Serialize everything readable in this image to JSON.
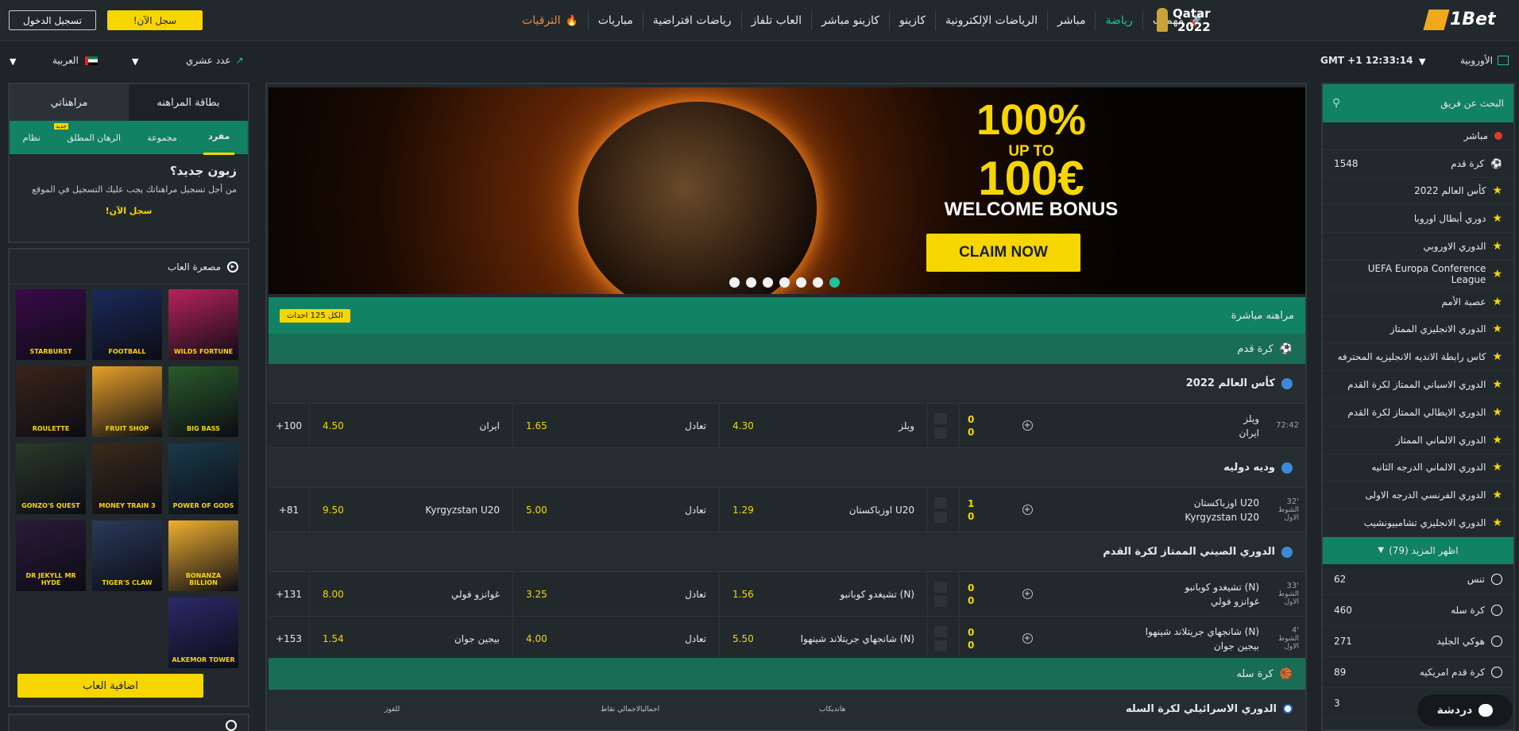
{
  "header": {
    "logo": "1Bet",
    "qatar_logo_line1": "Qatar",
    "qatar_logo_line2": "2022",
    "register_label": "!سجل الآن",
    "login_label": "تسجيل الدخول",
    "nav": [
      {
        "label": "مهمات",
        "icon": "rocket-icon"
      },
      {
        "label": "رياضة"
      },
      {
        "label": "مباشر"
      },
      {
        "label": "الرياضات الإلكترونية"
      },
      {
        "label": "كازينو"
      },
      {
        "label": "كازينو مباشر"
      },
      {
        "label": "العاب تلفاز"
      },
      {
        "label": "رياضات افتراضية"
      },
      {
        "label": "مباريات"
      },
      {
        "label": "الترقيات",
        "icon": "fire-icon"
      }
    ]
  },
  "subbar": {
    "odds_format": "الأوروبية",
    "time": "GMT +1 12:33:14",
    "decimal": "عدد عشري",
    "language": "العربية"
  },
  "search": {
    "placeholder": "البحث عن فريق"
  },
  "sports_menu": {
    "live": "مباشر",
    "football": {
      "label": "كرة قدم",
      "count": "1548"
    },
    "leagues": [
      "كأس العالم 2022",
      "دوري أبطال اوروبا",
      "الدوري الاوروبي",
      "UEFA Europa Conference League",
      "عصبة الأمم",
      "الدوري الانجليزي الممتاز",
      "كاس رابطة الانديه الانجليزيه المحترفه",
      "الدوري الاسباني الممتاز لكرة القدم",
      "الدوري الايطالي الممتاز لكرة القدم",
      "الدوري الالماني الممتاز",
      "الدوري الالماني الدرجه الثانيه",
      "الدوري الفرنسي الدرجه الاولى",
      "الدوري الانجليزي تشامبيونشيب"
    ],
    "show_more": "اظهر المزيد (79)",
    "others": [
      {
        "label": "تنس",
        "count": "62",
        "icon": "tennis-icon"
      },
      {
        "label": "كرة سله",
        "count": "460",
        "icon": "basketball-icon"
      },
      {
        "label": "هوكي الجليد",
        "count": "271",
        "icon": "hockey-icon"
      },
      {
        "label": "كرة قدم امريكيه",
        "count": "89",
        "icon": "american-football-icon"
      },
      {
        "label": "",
        "count": "3",
        "icon": "sport-icon"
      }
    ]
  },
  "banner": {
    "pct": "100%",
    "upto": "UP TO",
    "amount": "100€",
    "welcome": "WELCOME BONUS",
    "cta": "CLAIM NOW",
    "slides": 7,
    "active_slide": 7
  },
  "live": {
    "title": "مراهنه مباشرة",
    "total_badge": "الكل 125 احداث",
    "sport": "كرة قدم",
    "groups": [
      {
        "name": "كأس العالم 2022",
        "matches": [
          {
            "time": "72:42",
            "period": "",
            "team1": "ويلز",
            "team2": "ايران",
            "s1": "0",
            "s2": "0",
            "odd1_label": "ويلز",
            "odd1": "4.30",
            "draw_label": "تعادل",
            "draw": "1.65",
            "odd2_label": "ايران",
            "odd2": "4.50",
            "more": "+100"
          }
        ]
      },
      {
        "name": "وديه دوليه",
        "matches": [
          {
            "time": "32'",
            "period": "الشوط الاول",
            "team1": "اوزباكستان U20",
            "team2": "Kyrgyzstan U20",
            "s1": "1",
            "s2": "0",
            "odd1_label": "اوزباكستان U20",
            "odd1": "1.29",
            "draw_label": "تعادل",
            "draw": "5.00",
            "odd2_label": "Kyrgyzstan U20",
            "odd2": "9.50",
            "more": "+81"
          }
        ]
      },
      {
        "name": "الدوري الصيني الممتاز لكرة القدم",
        "matches": [
          {
            "time": "33'",
            "period": "الشوط الاول",
            "team1": "تشيغدو كوبانبو (N)",
            "team2": "غوانزو فولي",
            "s1": "0",
            "s2": "0",
            "odd1_label": "تشيغدو كوبانبو (N)",
            "odd1": "1.56",
            "draw_label": "تعادل",
            "draw": "3.25",
            "odd2_label": "غوانزو فولي",
            "odd2": "8.00",
            "more": "+131"
          },
          {
            "time": "4'",
            "period": "الشوط الاول",
            "team1": "شانجهاي جريتلاند شينهوا (N)",
            "team2": "بيجين جوان",
            "s1": "0",
            "s2": "0",
            "odd1_label": "شانجهاي جريتلاند شينهوا (N)",
            "odd1": "5.50",
            "draw_label": "تعادل",
            "draw": "4.00",
            "odd2_label": "بيجين جوان",
            "odd2": "1.54",
            "more": "+153"
          }
        ]
      }
    ],
    "basketball": {
      "sport": "كرة سله",
      "league": "الدوري الاسرائيلي لكرة السله",
      "cols": [
        "هانديكاب",
        "اجماليالاجمالي نقاط",
        "للفوز"
      ]
    }
  },
  "betslip": {
    "tab1": "بطاقة المراهنه",
    "tab2": "مراهناتي",
    "subtabs": [
      "مفرد",
      "مجموعة",
      "الرهان المطلق",
      "نظام"
    ],
    "new_badge": "جديد",
    "new_customer": "زبون جديد؟",
    "desc": "من أجل تسجيل مراهناتك يجب عليك التسجيل في الموقع",
    "register": "سجل الآن!"
  },
  "games": {
    "title": "مصعرة العاب",
    "more": "اضافية العاب",
    "tiles": [
      {
        "name": "WILDS FORTUNE",
        "color": "#b8235a"
      },
      {
        "name": "FOOTBALL",
        "color": "#1c2a5a"
      },
      {
        "name": "STARBURST",
        "color": "#3a0a4a"
      },
      {
        "name": "BIG BASS",
        "color": "#2a5a2a"
      },
      {
        "name": "FRUIT SHOP",
        "color": "#e8a028"
      },
      {
        "name": "ROULETTE",
        "color": "#3a2418"
      },
      {
        "name": "POWER OF GODS",
        "color": "#1a3a4a"
      },
      {
        "name": "MONEY TRAIN 3",
        "color": "#3a2a1a"
      },
      {
        "name": "GONZO'S QUEST",
        "color": "#2a3a2a"
      },
      {
        "name": "BONANZA BILLION",
        "color": "#f0b030"
      },
      {
        "name": "TIGER'S CLAW",
        "color": "#2a3a5a"
      },
      {
        "name": "DR JEKYLL MR HYDE",
        "color": "#2a1a3a"
      },
      {
        "name": "ALKEMOR TOWER",
        "color": "#2a2a6a"
      }
    ]
  },
  "chat": {
    "label": "دردشة"
  }
}
